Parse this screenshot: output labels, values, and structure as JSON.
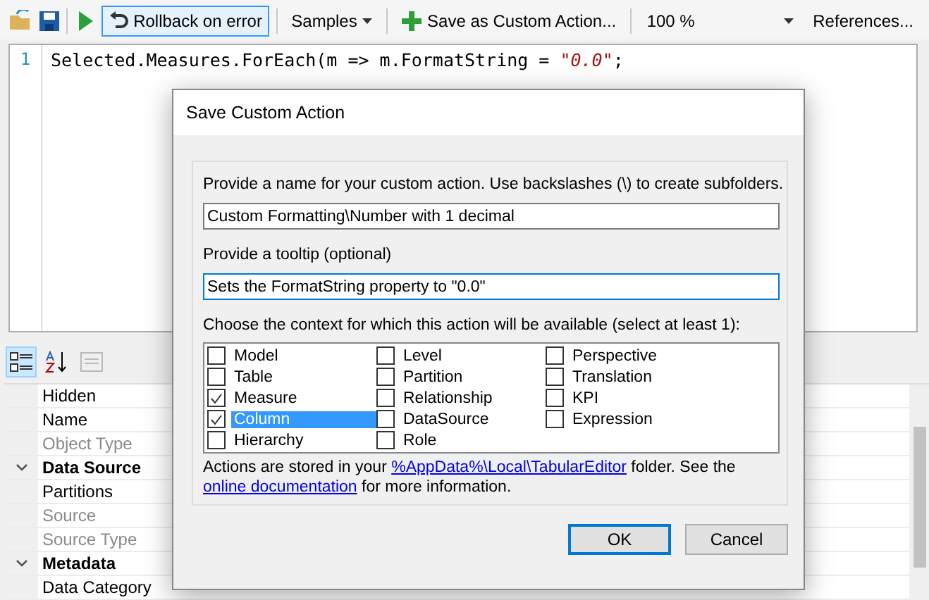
{
  "toolbar": {
    "items": [
      {
        "kind": "icon"
      },
      {
        "kind": "icon"
      },
      {
        "kind": "separator"
      },
      {
        "kind": "icon"
      },
      {
        "kind": "toggle",
        "label": "Rollback on error",
        "selected": true
      },
      {
        "kind": "separator"
      },
      {
        "kind": "dropdown",
        "label": "Samples"
      },
      {
        "kind": "separator"
      },
      {
        "kind": "button",
        "label": "Save as Custom Action..."
      },
      {
        "kind": "separator"
      },
      {
        "kind": "combo",
        "label": "100 %"
      },
      {
        "kind": "button",
        "label": "References..."
      }
    ]
  },
  "editor": {
    "lines": [
      {
        "number": "1",
        "tokens": [
          {
            "kind": "code",
            "text": "Selected.Measures.ForEach(m => m.FormatString = "
          },
          {
            "kind": "string",
            "text": "\"0.0\""
          },
          {
            "kind": "code",
            "text": ";"
          }
        ]
      }
    ]
  },
  "properties": {
    "toolbar": [
      {
        "selected": true
      },
      {
        "selected": false
      },
      {
        "selected": false,
        "disabled": true
      }
    ],
    "rows": [
      {
        "kind": "property",
        "label": "Hidden",
        "readonly": false
      },
      {
        "kind": "property",
        "label": "Name",
        "readonly": false
      },
      {
        "kind": "property",
        "label": "Object Type",
        "readonly": true
      },
      {
        "kind": "category",
        "label": "Data Source",
        "expanded": true
      },
      {
        "kind": "property",
        "label": "Partitions",
        "readonly": false
      },
      {
        "kind": "property",
        "label": "Source",
        "readonly": true
      },
      {
        "kind": "property",
        "label": "Source Type",
        "readonly": true
      },
      {
        "kind": "category",
        "label": "Metadata",
        "expanded": true
      },
      {
        "kind": "property",
        "label": "Data Category",
        "readonly": false
      }
    ]
  },
  "dialog": {
    "title": "Save Custom Action",
    "name_prompt": "Provide a name for your custom action. Use backslashes (\\) to create subfolders.",
    "name_value": "Custom Formatting\\Number with 1 decimal",
    "tooltip_prompt": "Provide a tooltip (optional)",
    "tooltip_value": "Sets the FormatString property to \"0.0\"",
    "context_prompt": "Choose the context for which this action will be available (select at least 1):",
    "contexts": [
      {
        "label": "Model",
        "checked": false,
        "selected": false
      },
      {
        "label": "Table",
        "checked": false,
        "selected": false
      },
      {
        "label": "Measure",
        "checked": true,
        "selected": false
      },
      {
        "label": "Column",
        "checked": true,
        "selected": true
      },
      {
        "label": "Hierarchy",
        "checked": false,
        "selected": false
      },
      {
        "label": "Level",
        "checked": false,
        "selected": false
      },
      {
        "label": "Partition",
        "checked": false,
        "selected": false
      },
      {
        "label": "Relationship",
        "checked": false,
        "selected": false
      },
      {
        "label": "DataSource",
        "checked": false,
        "selected": false
      },
      {
        "label": "Role",
        "checked": false,
        "selected": false
      },
      {
        "label": "Perspective",
        "checked": false,
        "selected": false
      },
      {
        "label": "Translation",
        "checked": false,
        "selected": false
      },
      {
        "label": "KPI",
        "checked": false,
        "selected": false
      },
      {
        "label": "Expression",
        "checked": false,
        "selected": false
      }
    ],
    "note": [
      {
        "kind": "text",
        "text": "Actions are stored in your "
      },
      {
        "kind": "link",
        "text": "%AppData%\\Local\\TabularEditor"
      },
      {
        "kind": "text",
        "text": " folder. See the "
      },
      {
        "kind": "link",
        "text": "online documentation"
      },
      {
        "kind": "text",
        "text": " for more information."
      }
    ],
    "buttons": [
      {
        "label": "OK",
        "default": true
      },
      {
        "label": "Cancel",
        "default": false
      }
    ]
  }
}
